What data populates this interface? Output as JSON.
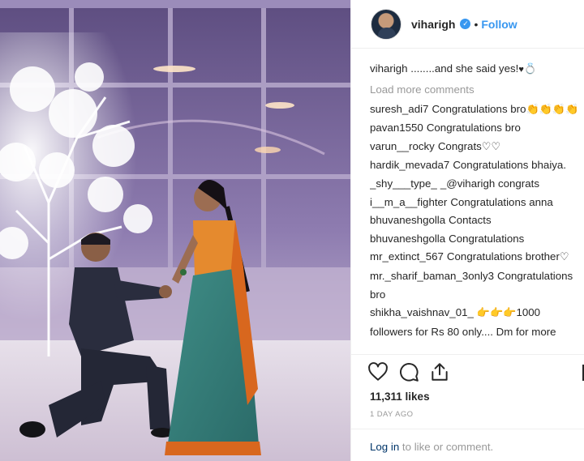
{
  "header": {
    "username": "viharigh",
    "separator": "•",
    "follow_label": "Follow"
  },
  "caption": {
    "username": "viharigh",
    "text": "........and she said yes!",
    "heart": "♥",
    "ring": "💍"
  },
  "load_more_label": "Load more comments",
  "comments": [
    {
      "user": "suresh_adi7",
      "text": "Congratulations bro",
      "emoji": "👏👏👏👏"
    },
    {
      "user": "pavan1550",
      "text": "Congratulations bro",
      "emoji": ""
    },
    {
      "user": "varun__rocky",
      "text": "Congrats",
      "emoji": "♡♡"
    },
    {
      "user": "hardik_mevada7",
      "text": "Congratulations bhaiya.",
      "emoji": ""
    },
    {
      "user": "_shy___type_",
      "text": "_@viharigh congrats",
      "emoji": ""
    },
    {
      "user": "i__m_a__fighter",
      "text": "Congratulations anna",
      "emoji": ""
    },
    {
      "user": "bhuvaneshgolla",
      "text": "Contacts",
      "emoji": ""
    },
    {
      "user": "bhuvaneshgolla",
      "text": "Congratulations",
      "emoji": ""
    },
    {
      "user": "mr_extinct_567",
      "text": "Congratulations brother",
      "emoji": "♡"
    },
    {
      "user": "mr._sharif_baman_3only3",
      "text": "Congratulations bro",
      "emoji": ""
    },
    {
      "user": "shikha_vaishnav_01_",
      "text": "1000 followers for Rs 80 only.... Dm for more",
      "emoji": "👉👉👉"
    }
  ],
  "likes_text": "11,311 likes",
  "time_text": "1 DAY AGO",
  "login": {
    "link": "Log in",
    "rest": " to like or comment."
  },
  "icons": [
    "heart-icon",
    "comment-icon",
    "share-icon",
    "bookmark-icon"
  ]
}
